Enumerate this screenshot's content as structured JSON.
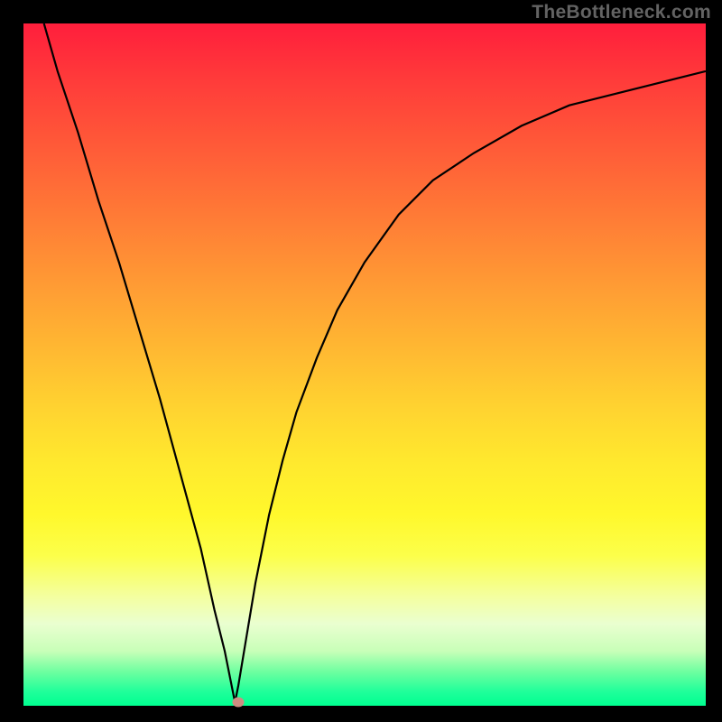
{
  "watermark": "TheBottleneck.com",
  "chart_data": {
    "type": "line",
    "title": "",
    "xlabel": "",
    "ylabel": "",
    "xlim": [
      0,
      100
    ],
    "ylim": [
      0,
      100
    ],
    "x": [
      3,
      5,
      8,
      11,
      14,
      17,
      20,
      23,
      26,
      28,
      29.5,
      30.5,
      31,
      31.5,
      32,
      33,
      34,
      35,
      36,
      38,
      40,
      43,
      46,
      50,
      55,
      60,
      66,
      73,
      80,
      88,
      96,
      100
    ],
    "values": [
      100,
      93,
      84,
      74,
      65,
      55,
      45,
      34,
      23,
      14,
      8,
      3,
      0.5,
      3,
      6,
      12,
      18,
      23,
      28,
      36,
      43,
      51,
      58,
      65,
      72,
      77,
      81,
      85,
      88,
      90,
      92,
      93
    ],
    "marker": {
      "x": 31.5,
      "y": 0.5
    },
    "background_gradient": {
      "top": "#ff1e3c",
      "mid": "#ffe82e",
      "bottom": "#00ff90"
    }
  }
}
